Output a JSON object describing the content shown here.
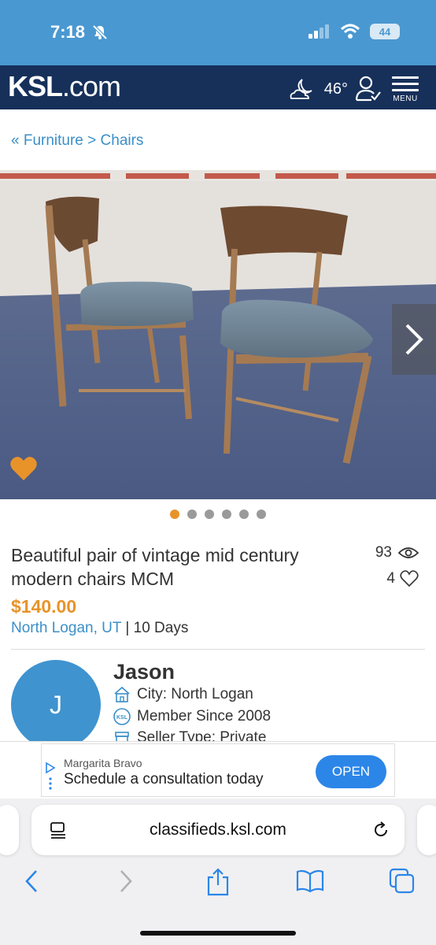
{
  "status_bar": {
    "time": "7:18",
    "battery": "44"
  },
  "header": {
    "logo_main": "KSL",
    "logo_suffix": ".com",
    "temperature": "46°",
    "menu_label": "MENU"
  },
  "breadcrumb": "« Furniture > Chairs",
  "gallery": {
    "total_photos": 6,
    "active_index": 0
  },
  "listing": {
    "title": "Beautiful pair of vintage mid century modern chairs MCM",
    "views": "93",
    "favorites": "4",
    "price": "$140.00",
    "location": "North Logan, UT",
    "age": "| 10 Days"
  },
  "seller": {
    "initial": "J",
    "name": "Jason",
    "city": "City: North Logan",
    "member_since": "Member Since 2008",
    "seller_type": "Seller Type: Private",
    "ksl_badge": "KSL"
  },
  "ad": {
    "sponsor": "Margarita Bravo",
    "text": "Schedule a consultation today",
    "cta": "OPEN"
  },
  "browser": {
    "url": "classifieds.ksl.com"
  },
  "colors": {
    "header_bg": "#16305a",
    "status_bg": "#4a98d1",
    "accent_orange": "#e8932a",
    "link_blue": "#3b8fc9"
  }
}
